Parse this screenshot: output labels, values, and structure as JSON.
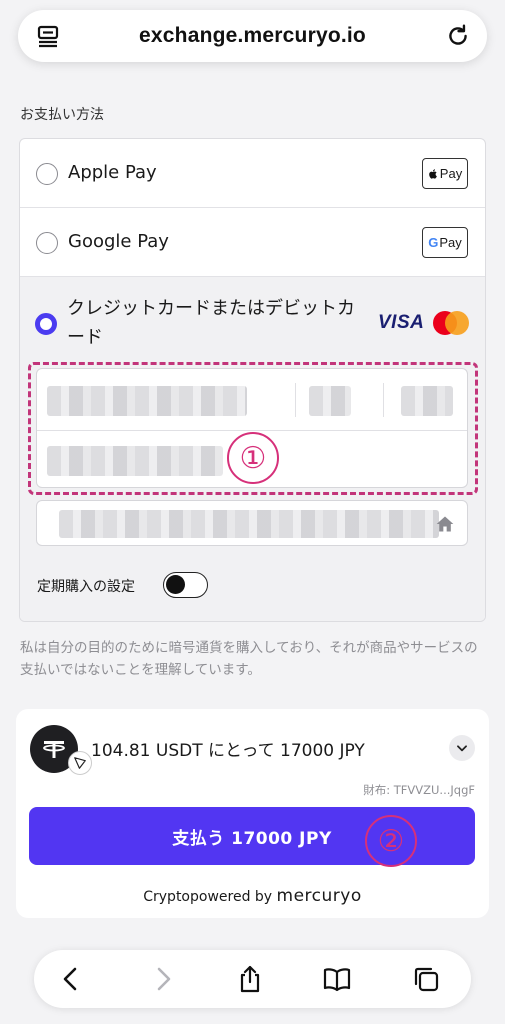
{
  "browser": {
    "url": "exchange.mercuryo.io",
    "tabs_icon": "tabs-icon",
    "reload_icon": "reload-icon"
  },
  "payment": {
    "section_label": "お支払い方法",
    "options": [
      {
        "label": "Apple Pay",
        "badge": "Pay",
        "selected": false
      },
      {
        "label": "Google Pay",
        "badge": "Pay",
        "selected": false
      },
      {
        "label": "クレジットカードまたはデビットカード",
        "badge": "VISA",
        "selected": true
      }
    ],
    "subscription_label": "定期購入の設定",
    "subscription_on": false,
    "disclaimer": "私は自分の目的のために暗号通貨を購入しており、それが商品やサービスの支払いではないことを理解しています。"
  },
  "markers": {
    "one": "①",
    "two": "②"
  },
  "order": {
    "quote": "104.81 USDT にとって 17000 JPY",
    "wallet": "財布: TFVVZU...JqgF",
    "pay_button": "支払う 17000 JPY",
    "powered_prefix": "Cryptopowered by",
    "powered_brand": "mercuryo"
  },
  "colors": {
    "accent": "#5236f2",
    "marker": "#d6307a",
    "radio_selected": "#4b3cf0"
  }
}
